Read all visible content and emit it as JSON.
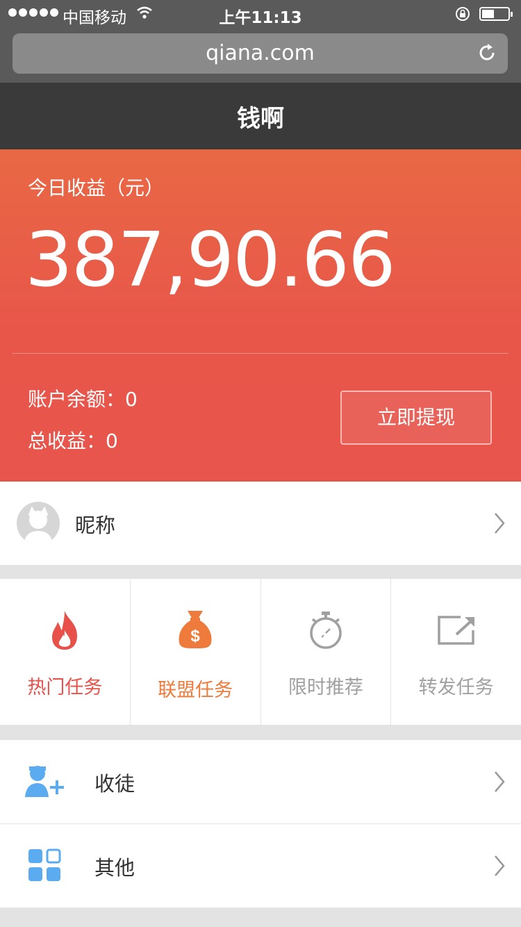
{
  "status_bar": {
    "carrier": "中国移动",
    "time": "上午11:13"
  },
  "browser": {
    "url": "qiana.com"
  },
  "header": {
    "title": "钱啊"
  },
  "earnings": {
    "today_label": "今日收益（元）",
    "today_amount": "387,90.66",
    "balance": "账户余额：0",
    "total": "总收益：0",
    "withdraw_label": "立即提现"
  },
  "profile": {
    "nickname": "昵称"
  },
  "tasks": [
    {
      "label": "热门任务",
      "icon": "flame-icon",
      "color": "#e8514a"
    },
    {
      "label": "联盟任务",
      "icon": "money-bag-icon",
      "color": "#ee7a3b"
    },
    {
      "label": "限时推荐",
      "icon": "stopwatch-icon",
      "color": "#a0a0a0"
    },
    {
      "label": "转发任务",
      "icon": "share-icon",
      "color": "#a0a0a0"
    }
  ],
  "menu": [
    {
      "label": "收徒",
      "icon": "add-user-icon"
    },
    {
      "label": "其他",
      "icon": "grid-icon"
    }
  ],
  "colors": {
    "accent": "#e8574b",
    "header_bg": "#3a3a3a",
    "icon_blue": "#5aabf0"
  }
}
